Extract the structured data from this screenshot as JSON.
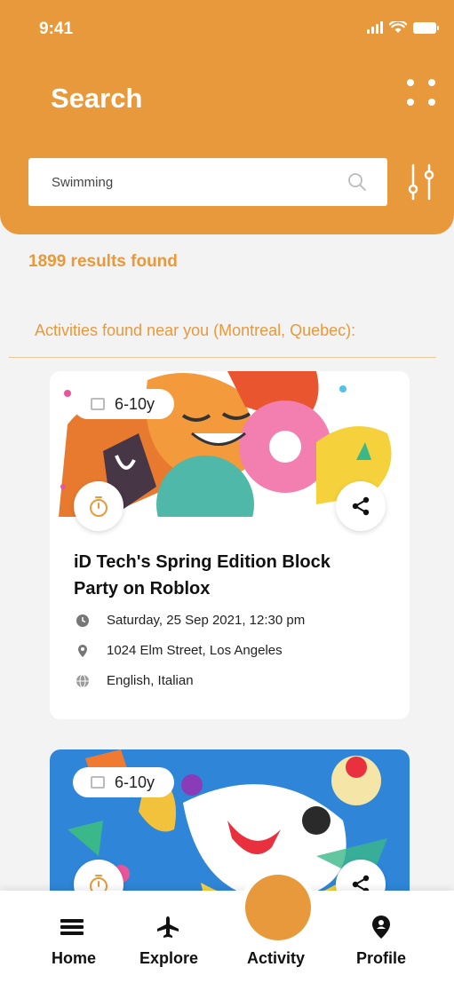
{
  "status_bar": {
    "time": "9:41"
  },
  "header": {
    "title": "Search"
  },
  "search": {
    "value": "Swimming",
    "placeholder": "Swimming"
  },
  "results_text": "1899 results found",
  "near_text": "Activities found near you (Montreal, Quebec):",
  "accent_color": "#e8993c",
  "cards": [
    {
      "age": "6-10y",
      "title": "iD Tech's Spring Edition Block Party on Roblox",
      "date": "Saturday, 25 Sep 2021, 12:30 pm",
      "address": "1024 Elm Street, Los Angeles",
      "languages": "English, Italian"
    },
    {
      "age": "6-10y"
    }
  ],
  "nav": {
    "items": [
      {
        "label": "Home",
        "icon": "menu-icon"
      },
      {
        "label": "Explore",
        "icon": "airplane-icon"
      },
      {
        "label": "Activity",
        "icon": "circle-button"
      },
      {
        "label": "Profile",
        "icon": "location-pin-icon"
      }
    ]
  }
}
